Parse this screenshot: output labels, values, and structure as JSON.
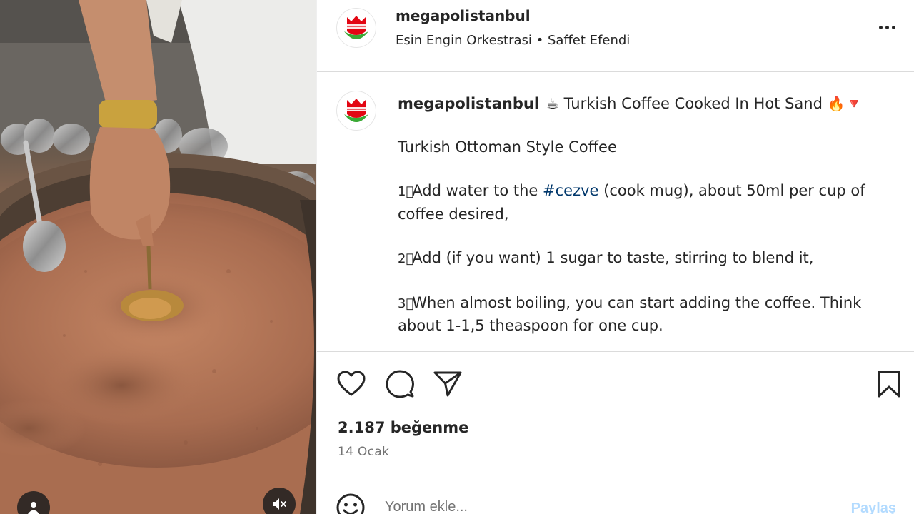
{
  "header": {
    "username": "megapolistanbul",
    "audio": "Esin Engin Orkestrasi • Saffet Efendi",
    "more_icon": "more-horizontal-icon"
  },
  "caption": {
    "username": "megapolistanbul",
    "title_emoji_left": "☕",
    "title": "Turkish Coffee Cooked In Hot Sand",
    "title_emoji_right": "🔥",
    "title_emoji_tail": "🔻",
    "line1": "Turkish Ottoman Style Coffee",
    "step1_num": "1⃣",
    "step1_pre": "Add water to the ",
    "step1_hashtag": "#cezve",
    "step1_post": " (cook mug), about 50ml per cup of coffee desired,",
    "step2_num": "2⃣",
    "step2": "Add (if you want) 1 sugar to taste, stirring to blend it,",
    "step3_num": "3⃣",
    "step3": "When almost boiling, you can start adding the coffee. Think about 1-1,5 theaspoon for one cup."
  },
  "actions": {
    "like_icon": "heart-icon",
    "comment_icon": "comment-icon",
    "share_icon": "send-icon",
    "save_icon": "bookmark-icon"
  },
  "stats": {
    "likes": "2.187 beğenme",
    "date": "14 Ocak"
  },
  "comment": {
    "placeholder": "Yorum ekle...",
    "post_label": "Paylaş"
  },
  "colors": {
    "hashtag": "#00376b",
    "secondary_text": "#737373",
    "post_button_disabled": "#b3dbff",
    "brand_red": "#e30613",
    "brand_green": "#3aa935"
  }
}
